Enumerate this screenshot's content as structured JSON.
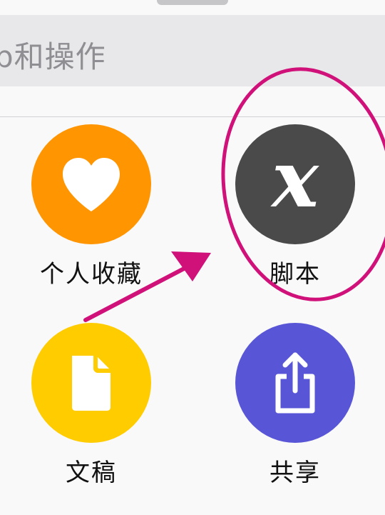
{
  "search": {
    "text": "p和操作"
  },
  "actions": [
    {
      "label": "个人收藏",
      "icon": "heart-icon",
      "color": "#ff9500"
    },
    {
      "label": "脚本",
      "icon": "script-x-icon",
      "color": "#4a4a4a"
    },
    {
      "label": "文稿",
      "icon": "document-icon",
      "color": "#ffcc00"
    },
    {
      "label": "共享",
      "icon": "share-icon",
      "color": "#5856d6"
    }
  ],
  "annotation": {
    "color": "#d0117a"
  }
}
